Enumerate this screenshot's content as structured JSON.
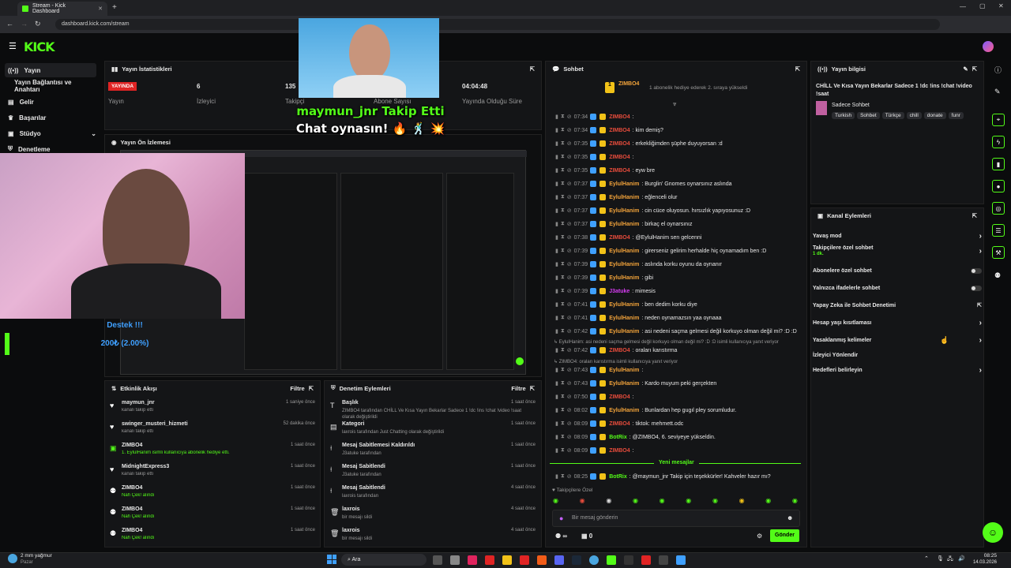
{
  "browser": {
    "tab_title": "Stream - Kick Dashboard",
    "url": "dashboard.kick.com/stream"
  },
  "brand": {
    "logo": "KICK",
    "accent": "#53fc18"
  },
  "sidebar": {
    "items": [
      {
        "label": "Yayın",
        "icon": "broadcast-icon"
      },
      {
        "label": "Yayın Bağlantısı ve Anahtarı"
      },
      {
        "label": "Gelir",
        "icon": "wallet-icon"
      },
      {
        "label": "Başarılar",
        "icon": "trophy-icon"
      },
      {
        "label": "Stüdyo",
        "icon": "studio-icon"
      },
      {
        "label": "Denetleme",
        "icon": "shield-icon"
      }
    ]
  },
  "stats": {
    "title": "Yayın İstatistikleri",
    "live": "YAYINDA",
    "live_label": "Yayın",
    "viewers": "6",
    "viewers_label": "İzleyici",
    "followers": "135",
    "followers_label": "Takipçi",
    "subs_label": "Abone Sayısı",
    "uptime": "04:04:48",
    "uptime_label": "Yayında Olduğu Süre"
  },
  "preview": {
    "title": "Yayın Ön İzlemesi"
  },
  "overlay": {
    "follow_text": "maymun_jnr Takip Etti",
    "follow_sub": "Chat oynasın! 🔥 🕺 💥",
    "donate_title": "Destek !!!",
    "donate_amount": "200₺ (2.00%)"
  },
  "chat": {
    "title": "Sohbet",
    "pinned_user": "ZIMBO4",
    "pinned_sub": "1 abonelik hediye ederek 2. sıraya yükseldi",
    "pinned_count": "1",
    "messages": [
      {
        "time": "07:34",
        "user": "ZIMBO4",
        "text": ":",
        "ucol": "#e74c3c"
      },
      {
        "time": "07:34",
        "user": "ZIMBO4",
        "text": ": kim demiş?",
        "ucol": "#e74c3c"
      },
      {
        "time": "07:35",
        "user": "ZIMBO4",
        "text": ": erkekliğimden şüphe duyuyorsan :d",
        "ucol": "#e74c3c"
      },
      {
        "time": "07:35",
        "user": "ZIMBO4",
        "text": ":",
        "ucol": "#e74c3c"
      },
      {
        "time": "07:35",
        "user": "ZIMBO4",
        "text": ": eyw bre",
        "ucol": "#e74c3c"
      },
      {
        "time": "07:37",
        "user": "EylulHanim",
        "text": ": Burglin' Gnomes oynarsınız aslında",
        "ucol": "#f2a33a"
      },
      {
        "time": "07:37",
        "user": "EylulHanim",
        "text": ": eğlenceli olur",
        "ucol": "#f2a33a"
      },
      {
        "time": "07:37",
        "user": "EylulHanim",
        "text": ": cin cüce oluyosun. hırsızlık yapıyosunuz :D",
        "ucol": "#f2a33a"
      },
      {
        "time": "07:37",
        "user": "EylulHanim",
        "text": ": birkaç el oynarsınız",
        "ucol": "#f2a33a"
      },
      {
        "time": "07:38",
        "user": "ZIMBO4",
        "text": ": @EylulHanim sen gelcenni",
        "ucol": "#e74c3c"
      },
      {
        "time": "07:39",
        "user": "EylulHanim",
        "text": ": girerseniz gelirim herhalde hiç oynamadım ben :D",
        "ucol": "#f2a33a"
      },
      {
        "time": "07:39",
        "user": "EylulHanim",
        "text": ": aslında korku oyunu da oynanır",
        "ucol": "#f2a33a"
      },
      {
        "time": "07:39",
        "user": "EylulHanim",
        "text": ": gibi",
        "ucol": "#f2a33a"
      },
      {
        "time": "07:39",
        "user": "J3atuke",
        "text": ": mimesis",
        "ucol": "#d63cf2"
      },
      {
        "time": "07:41",
        "user": "EylulHanim",
        "text": ": ben dedim korku diye",
        "ucol": "#f2a33a"
      },
      {
        "time": "07:41",
        "user": "EylulHanim",
        "text": ": neden oynamazsın yaa oynaaa",
        "ucol": "#f2a33a"
      },
      {
        "time": "07:42",
        "user": "EylulHanim",
        "text": ": asi nedeni saçma gelmesi değil korkuyo olman değil mi? :D :D",
        "ucol": "#f2a33a"
      }
    ],
    "reply1": "↳ EylulHanim: asi nedeni saçma gelmesi değil korkuyo olman değil mi? :D :D isimli kullanıcıya yanıt veriyor",
    "msg_b": [
      {
        "time": "07:42",
        "user": "ZIMBO4",
        "text": ": oraları karıstırma",
        "ucol": "#e74c3c"
      }
    ],
    "reply2": "↳ ZIMBO4: oraları karıstırma isimli kullanıcıya yanıt veriyor",
    "msg_c": [
      {
        "time": "07:43",
        "user": "EylulHanim",
        "text": ":",
        "ucol": "#f2a33a"
      },
      {
        "time": "07:43",
        "user": "EylulHanim",
        "text": ": Kardo muyum peki gerçekten",
        "ucol": "#f2a33a"
      },
      {
        "time": "07:50",
        "user": "ZIMBO4",
        "text": ":",
        "ucol": "#e74c3c"
      },
      {
        "time": "08:02",
        "user": "EylulHanim",
        "text": ": Bunlardan hep gugıl pley sorumludur.",
        "ucol": "#f2a33a"
      },
      {
        "time": "08:09",
        "user": "ZIMBO4",
        "text": ": tiktok: mehmett.odc",
        "ucol": "#e74c3c"
      },
      {
        "time": "08:09",
        "user": "BotRix",
        "text": ": @ZIMBO4, 6. seviyeye yükseldin.",
        "ucol": "#53fc18"
      },
      {
        "time": "08:09",
        "user": "ZIMBO4",
        "text": ":",
        "ucol": "#e74c3c"
      }
    ],
    "new_messages": "Yeni mesajlar",
    "last": {
      "time": "08:25",
      "user": "BotRix",
      "text": ": @maymun_jnr Takip için teşekkürler! Kahveler hazır mı?",
      "ucol": "#53fc18"
    },
    "followers_only": "Takipçilere Özel",
    "input_placeholder": "Bir mesaj gönderin",
    "points": "∞",
    "bag_count": "0",
    "send": "Gönder"
  },
  "stream_info": {
    "title": "Yayın bilgisi",
    "stream_title": "CHİLL Ve Kısa Yayın Bekarlar Sadece 1 !dc !ins !chat !video !saat",
    "category": "Sadece Sohbet",
    "tags": [
      "Turkish",
      "Sohbet",
      "Türkçe",
      "chill",
      "donate",
      "funr"
    ]
  },
  "channel_actions": {
    "title": "Kanal Eylemleri",
    "items": [
      {
        "label": "Yavaş mod",
        "kind": "arrow"
      },
      {
        "label": "Takipçilere özel sohbet",
        "sub": "1 dk.",
        "kind": "arrow"
      },
      {
        "label": "Abonelere özel sohbet",
        "kind": "toggle"
      },
      {
        "label": "Yalnızca ifadelerle sohbet",
        "kind": "toggle"
      },
      {
        "label": "Yapay Zeka ile Sohbet Denetimi",
        "kind": "ext"
      },
      {
        "label": "Hesap yaşı kısıtlaması",
        "kind": "arrow"
      },
      {
        "label": "Yasaklanmış kelimeler",
        "kind": "arrow"
      },
      {
        "label": "İzleyici Yönlendir",
        "kind": "none"
      },
      {
        "label": "Hedefleri belirleyin",
        "kind": "arrow"
      }
    ]
  },
  "activity": {
    "title": "Etkinlik Akışı",
    "filter": "Filtre",
    "items": [
      {
        "user": "maymun_jnr",
        "desc": "kanalı takip etti",
        "time": "1 saniye önce",
        "icon": "heart-icon"
      },
      {
        "user": "swinger_musteri_hizmeti",
        "desc": "kanalı takip etti",
        "time": "52 dakika önce",
        "icon": "heart-icon"
      },
      {
        "user": "ZIMBO4",
        "desc": "1. EylulHanim isimli kullanıcıya abonelik hediye etti.",
        "time": "1 saat önce",
        "icon": "gift-icon"
      },
      {
        "user": "MidnightExpress3",
        "desc": "kanalı takip etti",
        "time": "1 saat önce",
        "icon": "heart-icon"
      },
      {
        "user": "ZIMBO4",
        "desc": "Nah Çek! alındı",
        "time": "1 saat önce",
        "icon": "points-icon"
      },
      {
        "user": "ZIMBO4",
        "desc": "Nah Çek! alındı",
        "time": "1 saat önce",
        "icon": "points-icon"
      },
      {
        "user": "ZIMBO4",
        "desc": "Nah Çek! alındı",
        "time": "1 saat önce",
        "icon": "points-icon"
      }
    ]
  },
  "modlog": {
    "title": "Denetim Eylemleri",
    "filter": "Filtre",
    "items": [
      {
        "title": "Başlık",
        "desc": "ZIMBO4 tarafından CHİLL Ve Kısa Yayın Bekarlar Sadece 1 !dc !ins !chat !video !saat olarak değiştirildi",
        "time": "1 saat önce",
        "icon": "text-icon"
      },
      {
        "title": "Kategori",
        "desc": "laxrois tarafından Just Chatting olarak değiştirildi",
        "time": "1 saat önce",
        "icon": "category-icon"
      },
      {
        "title": "Mesaj Sabitlemesi Kaldırıldı",
        "desc": "J3atuke tarafından",
        "time": "1 saat önce",
        "icon": "unpin-icon"
      },
      {
        "title": "Mesaj Sabitlendi",
        "desc": "J3atuke tarafından",
        "time": "1 saat önce",
        "icon": "pin-icon"
      },
      {
        "title": "Mesaj Sabitlendi",
        "desc": "laxrois tarafından",
        "time": "4 saat önce",
        "icon": "pin-icon"
      },
      {
        "title": "laxrois",
        "desc": "bir mesajı sildi",
        "time": "4 saat önce",
        "icon": "trash-icon"
      },
      {
        "title": "laxrois",
        "desc": "bir mesajı sildi",
        "time": "4 saat önce",
        "icon": "trash-icon"
      }
    ]
  },
  "taskbar": {
    "weather": "2 mm yağmur",
    "weather_sub": "Pazar",
    "search": "Ara",
    "time": "08:25",
    "date": "14.03.2026"
  }
}
